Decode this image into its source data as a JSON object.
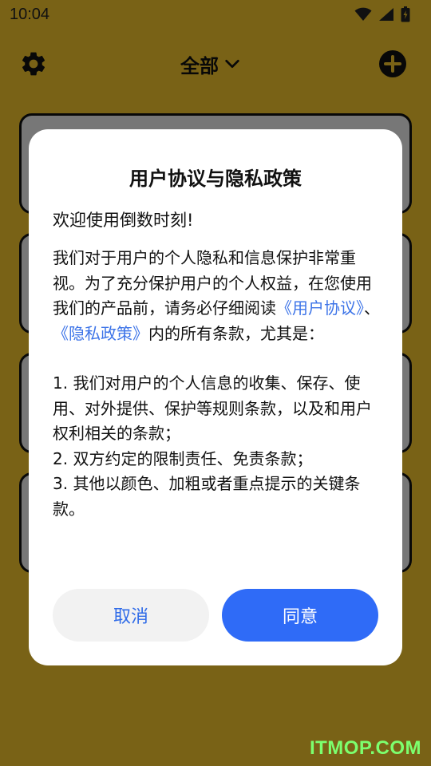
{
  "status_bar": {
    "time": "10:04"
  },
  "app_bar": {
    "filter_label": "全部"
  },
  "dialog": {
    "title": "用户协议与隐私政策",
    "welcome": "欢迎使用倒数时刻!",
    "intro_before": "我们对于用户的个人隐私和信息保护非常重视。为了充分保护用户的个人权益，在您使用我们的产品前，请务必仔细阅读",
    "link_agreement": "《用户协议》",
    "separator": "、",
    "link_privacy": "《隐私政策》",
    "intro_after": "内的所有条款，尤其是：",
    "items": [
      "1. 我们对用户的个人信息的收集、保存、使用、对外提供、保护等规则条款，以及和用户权利相关的条款；",
      "2. 双方约定的限制责任、免责条款；",
      "3. 其他以颜色、加粗或者重点提示的关键条款。"
    ],
    "cancel_label": "取消",
    "agree_label": "同意"
  },
  "watermark": "ITMOP.COM",
  "colors": {
    "background": "#F2C42C",
    "link": "#3D74E8",
    "primary_button": "#2F6BF7",
    "cancel_button_bg": "#F2F2F2",
    "watermark": "#7CFF6E"
  }
}
